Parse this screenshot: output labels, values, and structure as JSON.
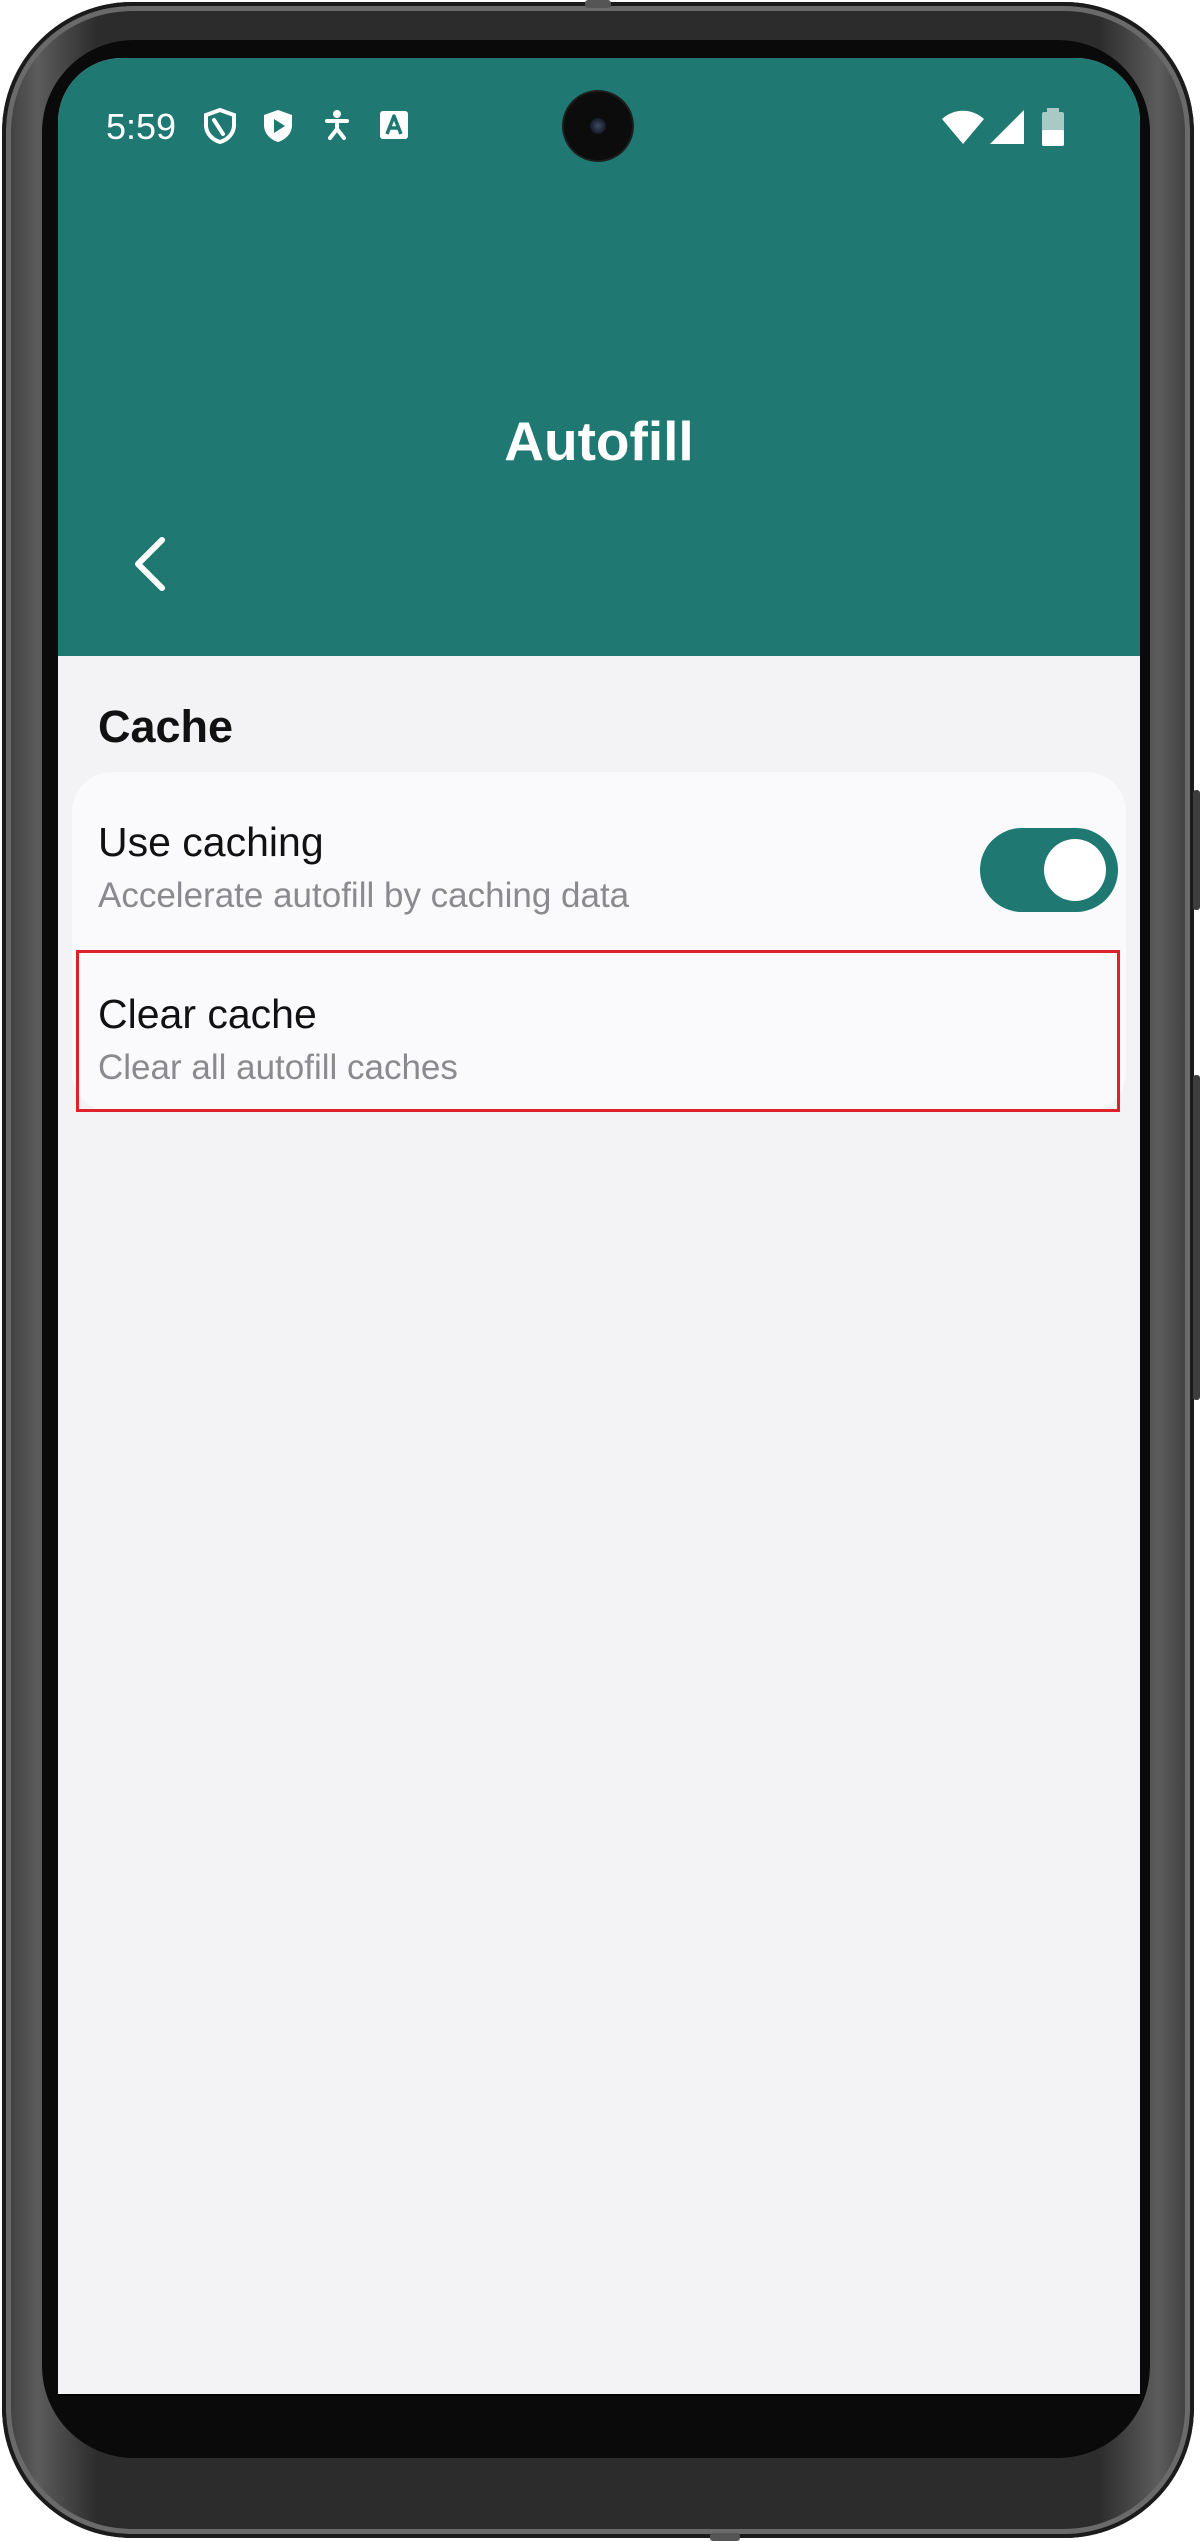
{
  "status_bar": {
    "time": "5:59",
    "left_icons": [
      "shield-outline-icon",
      "play-shield-icon",
      "accessibility-icon",
      "text-recognition-icon"
    ],
    "right_icons": [
      "wifi-icon",
      "cell-signal-icon",
      "battery-icon"
    ]
  },
  "app_bar": {
    "title": "Autofill",
    "back_icon": "chevron-left-icon",
    "color": "#1f7872"
  },
  "section": {
    "title": "Cache"
  },
  "settings": [
    {
      "title": "Use caching",
      "subtitle": "Accelerate autofill by caching data",
      "toggle_on": true
    },
    {
      "title": "Clear cache",
      "subtitle": "Clear all autofill caches",
      "highlighted": true,
      "highlight_color": "#e0202a"
    }
  ]
}
